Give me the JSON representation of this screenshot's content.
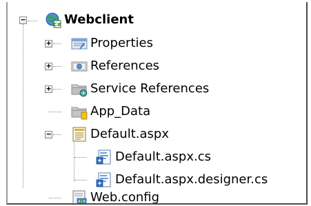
{
  "solution_explorer": {
    "project": {
      "label": "Webclient",
      "icon": "web-project-icon",
      "expanded": true
    },
    "items": [
      {
        "label": "Properties",
        "icon": "properties-icon",
        "expander": "plus"
      },
      {
        "label": "References",
        "icon": "references-icon",
        "expander": "plus"
      },
      {
        "label": "Service References",
        "icon": "service-references-icon",
        "expander": "plus"
      },
      {
        "label": "App_Data",
        "icon": "folder-icon",
        "expander": "none"
      },
      {
        "label": "Default.aspx",
        "icon": "aspx-page-icon",
        "expander": "minus"
      },
      {
        "label": "Default.aspx.cs",
        "icon": "cs-file-icon",
        "expander": "none"
      },
      {
        "label": "Default.aspx.designer.cs",
        "icon": "cs-file-icon",
        "expander": "none"
      },
      {
        "label": "Web.config",
        "icon": "config-file-icon",
        "expander": "none"
      }
    ]
  }
}
